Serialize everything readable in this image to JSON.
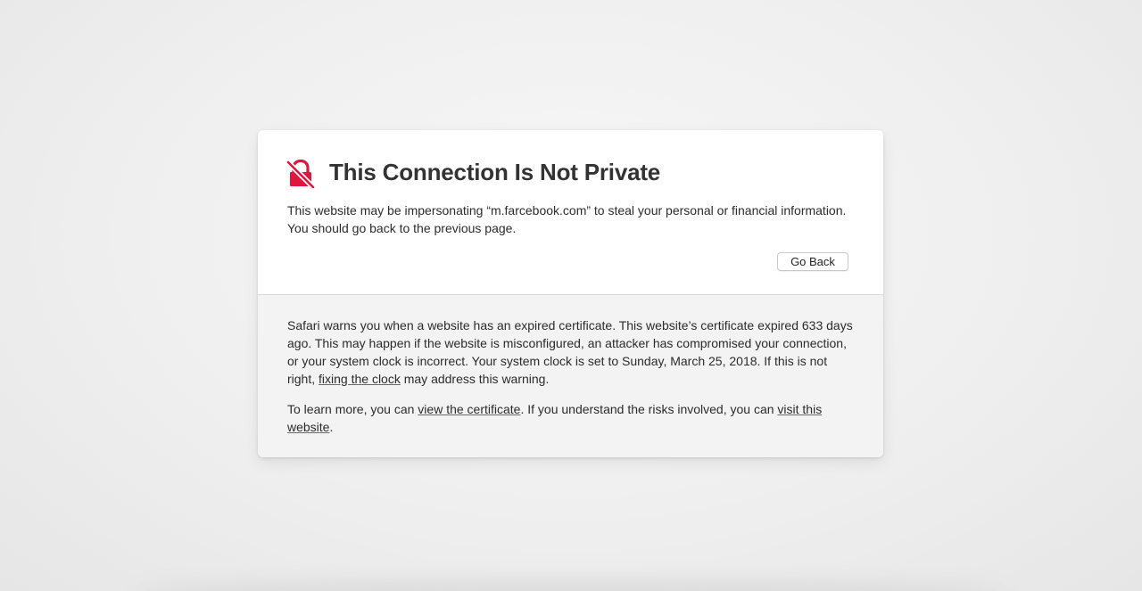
{
  "warning": {
    "icon": "broken-lock-icon",
    "icon_color": "#e0163e",
    "title": "This Connection Is Not Private",
    "message": "This website may be impersonating “m.farcebook.com” to steal your personal or financial information. You should go back to the previous page.",
    "go_back_label": "Go Back"
  },
  "details": {
    "paragraph_before_link": "Safari warns you when a website has an expired certificate. This website’s certificate expired 633 days ago. This may happen if the website is misconfigured, an attacker has compromised your connection, or your system clock is incorrect. Your system clock is set to Sunday, March 25, 2018. If this is not right, ",
    "fix_clock_link": "fixing the clock",
    "paragraph_after_link": " may address this warning.",
    "learn_prefix": "To learn more, you can ",
    "view_certificate_link": "view the certificate",
    "learn_middle": ". If you understand the risks involved, you can ",
    "visit_website_link": "visit this website",
    "learn_suffix": "."
  }
}
